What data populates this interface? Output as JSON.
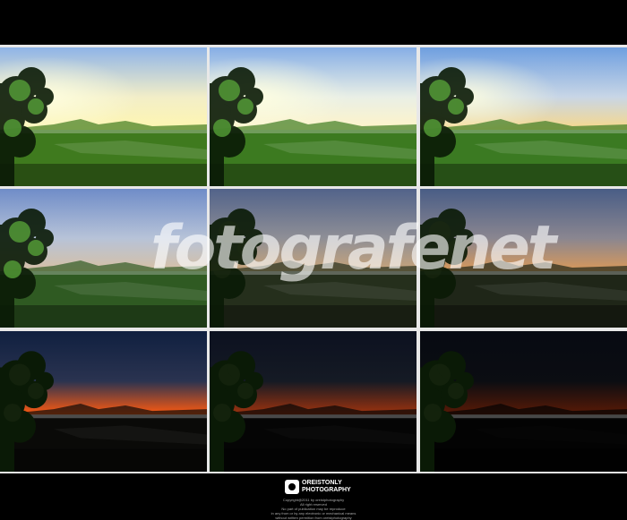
{
  "grid": {
    "tiles": [
      {
        "exposure": 1.0,
        "sky_top": "#8fb4e8",
        "sky_mid": "#f2eec8",
        "horizon": "#fff6b0",
        "ground": "#3f7a1e",
        "sun": true
      },
      {
        "exposure": 1.0,
        "sky_top": "#86aee6",
        "sky_mid": "#e9efe6",
        "horizon": "#fff4c8",
        "ground": "#3c7a20",
        "sun": true
      },
      {
        "exposure": 1.0,
        "sky_top": "#6f9fe0",
        "sky_mid": "#c8d6e6",
        "horizon": "#f8d88a",
        "ground": "#3b7a22",
        "sun": true
      },
      {
        "exposure": 0.78,
        "sky_top": "#6f8cc8",
        "sky_mid": "#b7c3d8",
        "horizon": "#d6c0a4",
        "ground": "#2f5a22",
        "sun": false
      },
      {
        "exposure": 0.6,
        "sky_top": "#52638a",
        "sky_mid": "#8f8f96",
        "horizon": "#c8a47a",
        "ground": "#252f1c",
        "sun": false
      },
      {
        "exposure": 0.55,
        "sky_top": "#495d86",
        "sky_mid": "#8a8690",
        "horizon": "#d9995a",
        "ground": "#1f2618",
        "sun": false
      },
      {
        "exposure": 0.35,
        "sky_top": "#102040",
        "sky_mid": "#2a3350",
        "horizon": "#ff5a10",
        "ground": "#0a0a08",
        "sun": false
      },
      {
        "exposure": 0.18,
        "sky_top": "#0c1120",
        "sky_mid": "#151a24",
        "horizon": "#a0330e",
        "ground": "#050505",
        "sun": false
      },
      {
        "exposure": 0.1,
        "sky_top": "#070a12",
        "sky_mid": "#0b0d12",
        "horizon": "#5a1a06",
        "ground": "#030303",
        "sun": false
      }
    ]
  },
  "watermark": "fotografenet",
  "footer": {
    "brand_line1": "OREISTONLY",
    "brand_line2": "PHOTOGRAPHY",
    "copyright": "Copyright@2011 by oreistphotography",
    "rights": "All right reserved",
    "notice1": "No part of publication may be reproduce",
    "notice2": "in any from or by any electronic or mechanical means",
    "notice3": "without written permition from oreistphotography"
  }
}
